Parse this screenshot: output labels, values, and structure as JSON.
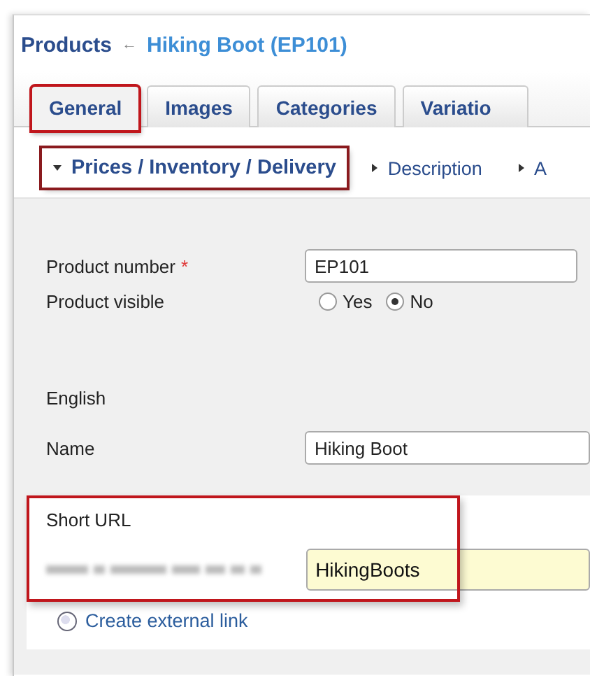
{
  "breadcrumb": {
    "parent": "Products",
    "separator": "←",
    "current": "Hiking Boot (EP101)"
  },
  "tabs": [
    {
      "label": "General",
      "selected": true,
      "highlighted": true
    },
    {
      "label": "Images",
      "selected": false,
      "highlighted": false
    },
    {
      "label": "Categories",
      "selected": false,
      "highlighted": false
    },
    {
      "label": "Variatio",
      "selected": false,
      "highlighted": false
    }
  ],
  "sections": [
    {
      "label": "Prices / Inventory / Delivery",
      "expanded": true,
      "highlighted": true
    },
    {
      "label": "Description",
      "expanded": false,
      "highlighted": false
    },
    {
      "label": "A",
      "expanded": false,
      "highlighted": false
    }
  ],
  "product_number": {
    "label": "Product number",
    "required_mark": "*",
    "value": "EP101"
  },
  "product_visible": {
    "label": "Product visible",
    "options": [
      {
        "label": "Yes",
        "selected": false
      },
      {
        "label": "No",
        "selected": true
      }
    ]
  },
  "language": "English",
  "name": {
    "label": "Name",
    "value": "Hiking Boot"
  },
  "short_url": {
    "label": "Short URL",
    "value": "HikingBoots",
    "highlighted": true
  },
  "external_link": "Create external link"
}
